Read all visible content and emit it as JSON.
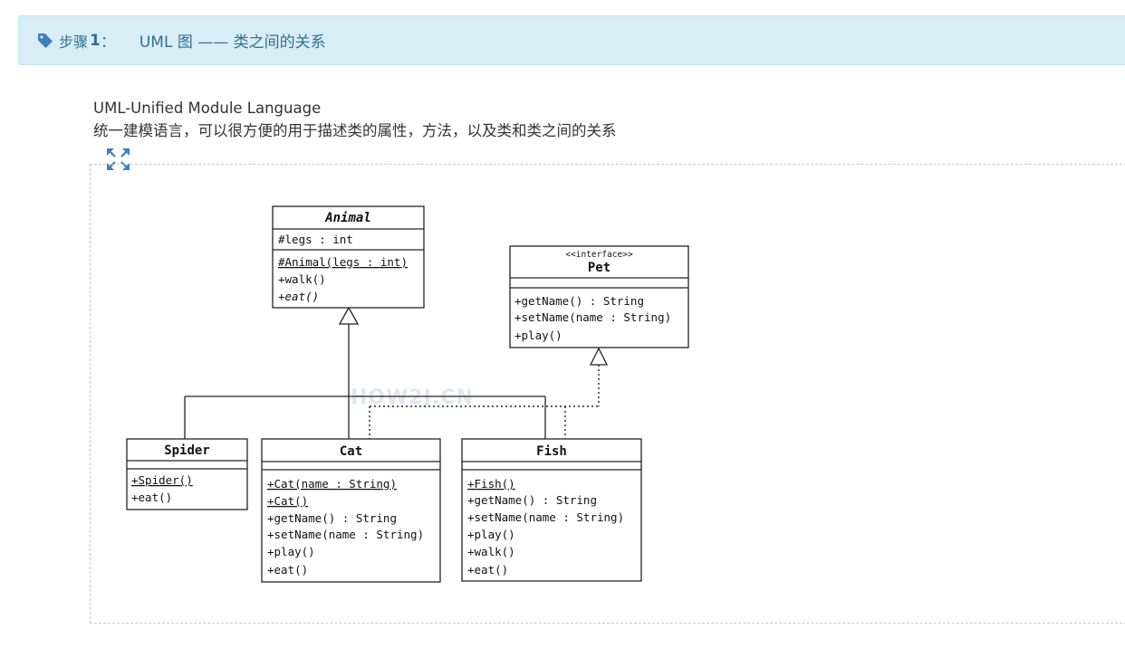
{
  "step": {
    "label": "步骤",
    "number": "1",
    "colon": "：",
    "title": "UML 图 —— 类之间的关系"
  },
  "intro": {
    "line1": "UML-Unified Module Language",
    "line2": "统一建模语言，可以很方便的用于描述类的属性，方法，以及类和类之间的关系"
  },
  "diagram": {
    "watermark": "HOW2J.CN",
    "classes": {
      "animal": {
        "name": "Animal",
        "attributes": [
          "#legs : int"
        ],
        "methods": [
          "#Animal(legs : int)",
          "+walk()",
          "+eat()"
        ]
      },
      "pet": {
        "stereotype": "<<interface>>",
        "name": "Pet",
        "methods": [
          "+getName() : String",
          "+setName(name : String)",
          "+play()"
        ]
      },
      "spider": {
        "name": "Spider",
        "methods": [
          "+Spider()",
          "+eat()"
        ]
      },
      "cat": {
        "name": "Cat",
        "methods": [
          "+Cat(name : String)",
          "+Cat()",
          "+getName() : String",
          "+setName(name : String)",
          "+play()",
          "+eat()"
        ]
      },
      "fish": {
        "name": "Fish",
        "methods": [
          "+Fish()",
          "+getName() : String",
          "+setName(name : String)",
          "+play()",
          "+walk()",
          "+eat()"
        ]
      }
    }
  },
  "icons": {
    "tag": "tag-icon",
    "expand": "expand-icon"
  },
  "colors": {
    "header_bg": "#d9edf7",
    "header_border": "#bce8f1",
    "header_text": "#31708f",
    "icon_blue": "#3a7fc1"
  }
}
